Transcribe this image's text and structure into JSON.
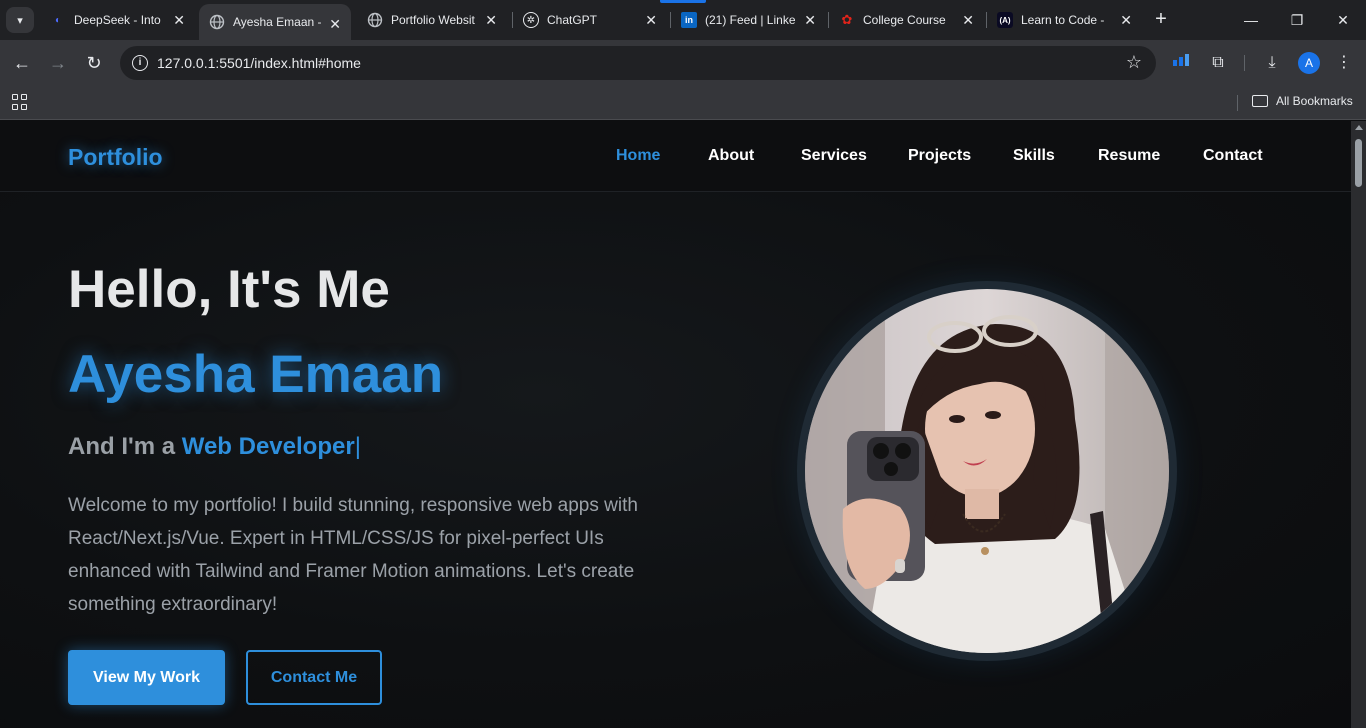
{
  "browser": {
    "tabs": [
      {
        "title": "DeepSeek - Into",
        "icon": "deepseek-icon"
      },
      {
        "title": "Ayesha Emaan -",
        "icon": "globe-icon",
        "active": true
      },
      {
        "title": "Portfolio Websit",
        "icon": "globe-icon"
      },
      {
        "title": "ChatGPT",
        "icon": "chatgpt-icon"
      },
      {
        "title": "(21) Feed | Linke",
        "icon": "linkedin-icon"
      },
      {
        "title": "College Course",
        "icon": "huawei-icon"
      },
      {
        "title": "Learn to Code -",
        "icon": "freecodecamp-icon"
      }
    ],
    "url": "127.0.0.1:5501/index.html#home",
    "bookmarks_label": "All Bookmarks",
    "profile_initial": "A"
  },
  "site": {
    "logo": "Portfolio",
    "nav": [
      "Home",
      "About",
      "Services",
      "Projects",
      "Skills",
      "Resume",
      "Contact"
    ],
    "active_nav": "Home",
    "hero": {
      "greeting": "Hello, It's Me",
      "name": "Ayesha Emaan",
      "role_prefix": "And I'm a",
      "role": "Web Developer",
      "caret": "|",
      "intro": "Welcome to my portfolio! I build stunning, responsive web apps with React/Next.js/Vue. Expert in HTML/CSS/JS for pixel-perfect UIs enhanced with Tailwind and Framer Motion animations. Let's create something extraordinary!",
      "primary_button": "View My Work",
      "secondary_button": "Contact Me"
    }
  },
  "colors": {
    "accent": "#2e8fdc",
    "background": "#0d0e10",
    "text_muted": "#9ba1a8"
  }
}
